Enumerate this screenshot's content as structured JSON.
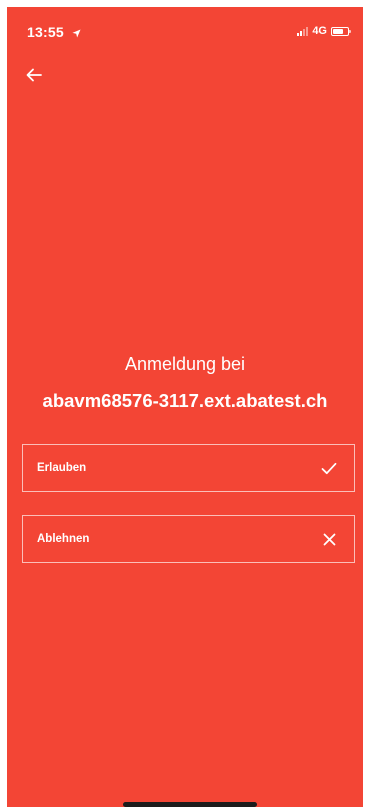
{
  "status_bar": {
    "time": "13:55",
    "network": "4G",
    "location_icon": "location-arrow-icon",
    "battery_icon": "battery-icon",
    "signal_icon": "signal-icon"
  },
  "nav": {
    "back_icon": "arrow-left-icon"
  },
  "prompt": {
    "title": "Anmeldung bei",
    "host": "abavm68576-3117.ext.abatest.ch"
  },
  "options": {
    "allow": {
      "label": "Erlauben",
      "icon": "checkmark-icon"
    },
    "deny": {
      "label": "Ablehnen",
      "icon": "close-icon"
    }
  },
  "colors": {
    "background": "#f34535",
    "foreground": "#ffffff"
  }
}
